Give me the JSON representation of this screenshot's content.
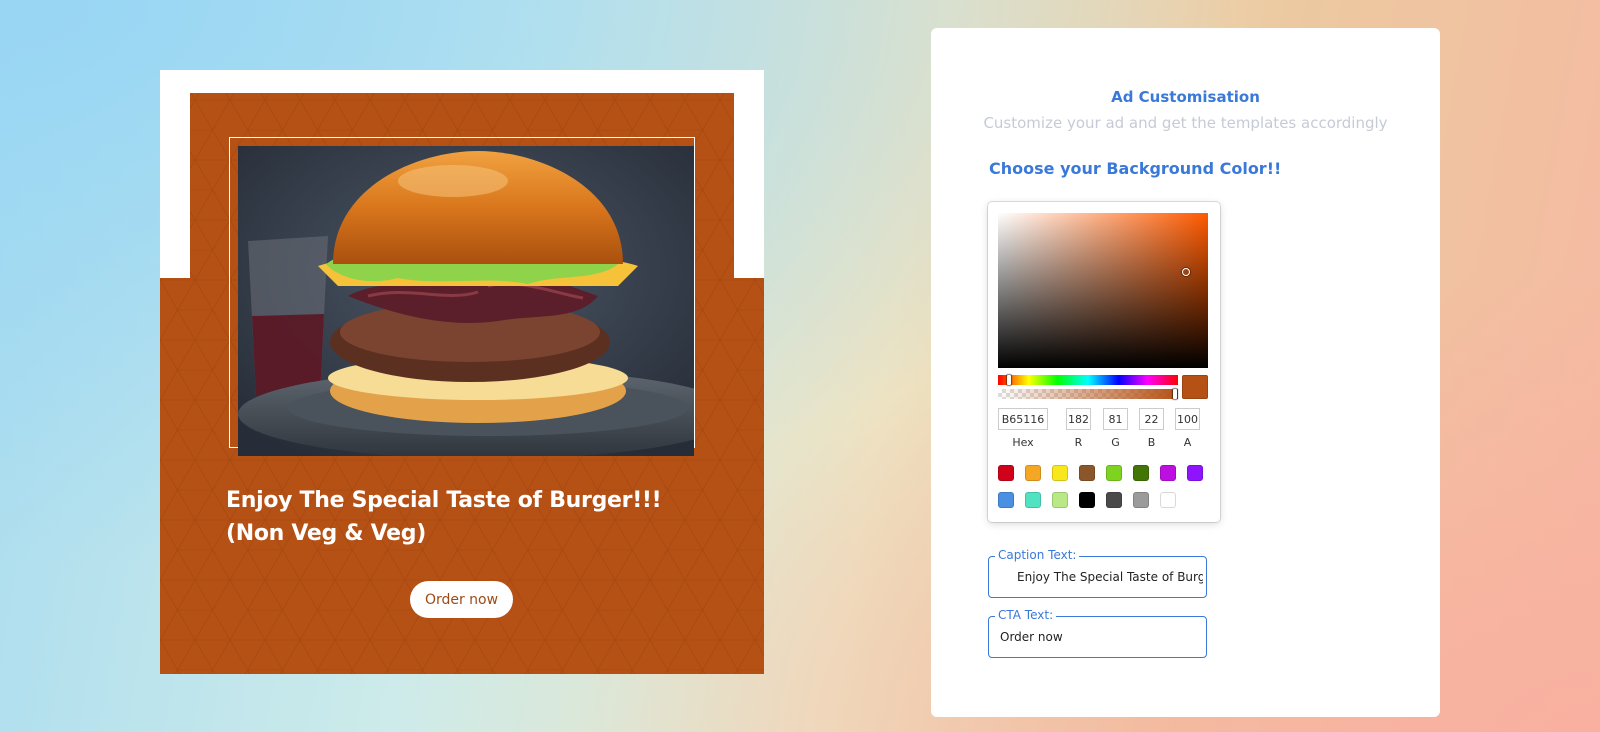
{
  "ad": {
    "background_color": "#B65116",
    "photo_description_icon": "burger-photo",
    "caption": "Enjoy The Special Taste of Burger!!! (Non Veg & Veg)",
    "cta_label": "Order now"
  },
  "panel": {
    "title": "Ad Customisation",
    "subtitle": "Customize your ad and get the templates accordingly",
    "bg_heading": "Choose your Background Color!!"
  },
  "picker": {
    "hex": "B65116",
    "r": "182",
    "g": "81",
    "b": "22",
    "a": "100",
    "labels": {
      "hex": "Hex",
      "r": "R",
      "g": "G",
      "b": "B",
      "a": "A"
    },
    "preset_colors": [
      "#D0021B",
      "#F5A623",
      "#F8E71C",
      "#8B572A",
      "#7ED321",
      "#417505",
      "#BD10E0",
      "#9013FE",
      "#4A90E2",
      "#50E3C2",
      "#B8E986",
      "#000000",
      "#4A4A4A",
      "#9B9B9B",
      "#FFFFFF"
    ]
  },
  "caption_field": {
    "label": "Caption Text:",
    "value": "Enjoy The Special Taste of Burge"
  },
  "cta_field": {
    "label": "CTA Text:",
    "value": "Order now"
  },
  "colors": {
    "accent": "#3A79D8",
    "ad_background": "#B65116"
  }
}
